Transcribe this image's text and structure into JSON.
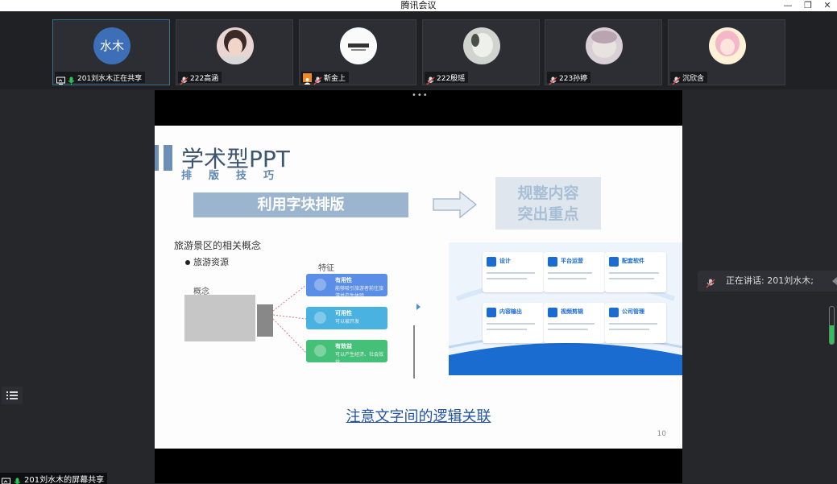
{
  "window": {
    "title": "腾讯会议",
    "min": "—",
    "restore": "❐",
    "close": "✕"
  },
  "participants": [
    {
      "name": "201刘水木正在共享",
      "avatar_text": "水木",
      "mic": "on",
      "sharing": true
    },
    {
      "name": "222高涵",
      "mic": "muted"
    },
    {
      "name": "靳金上",
      "mic": "muted",
      "cam": "user"
    },
    {
      "name": "222殷瑶",
      "mic": "muted"
    },
    {
      "name": "223孙婷",
      "mic": "muted"
    },
    {
      "name": "沉欣含",
      "mic": "muted"
    }
  ],
  "slide": {
    "title": "学术型PPT",
    "subtitle": "排版技巧",
    "block_left": "利用字块排版",
    "block_right": "规整内容突出重点",
    "section_title": "旅游景区的相关概念",
    "bullet": "旅游资源",
    "features_label": "特征",
    "concept_label": "概念",
    "features": [
      {
        "title": "有用性",
        "sub": "能够吸引旅游者前往旅游并产生体验"
      },
      {
        "title": "可用性",
        "sub": "可以被开发"
      },
      {
        "title": "有效益",
        "sub": "可以产生经济、社会效益"
      }
    ],
    "cards": [
      {
        "title": "设计"
      },
      {
        "title": "平台运营"
      },
      {
        "title": "配套软件"
      },
      {
        "title": "内容输出"
      },
      {
        "title": "视频剪辑"
      },
      {
        "title": "公司管理"
      }
    ],
    "bottom_title": "注意文字间的逻辑关联",
    "page_number": "10"
  },
  "speaking": {
    "label": "正在讲话:",
    "name": "201刘水木;"
  },
  "volume_level": 0.5,
  "share_label": "201刘水木的屏幕共享",
  "colors": {
    "feat1": "#5b8ee6",
    "feat2": "#4ab2e0",
    "feat3": "#44c079",
    "accent": "#2453a4"
  }
}
